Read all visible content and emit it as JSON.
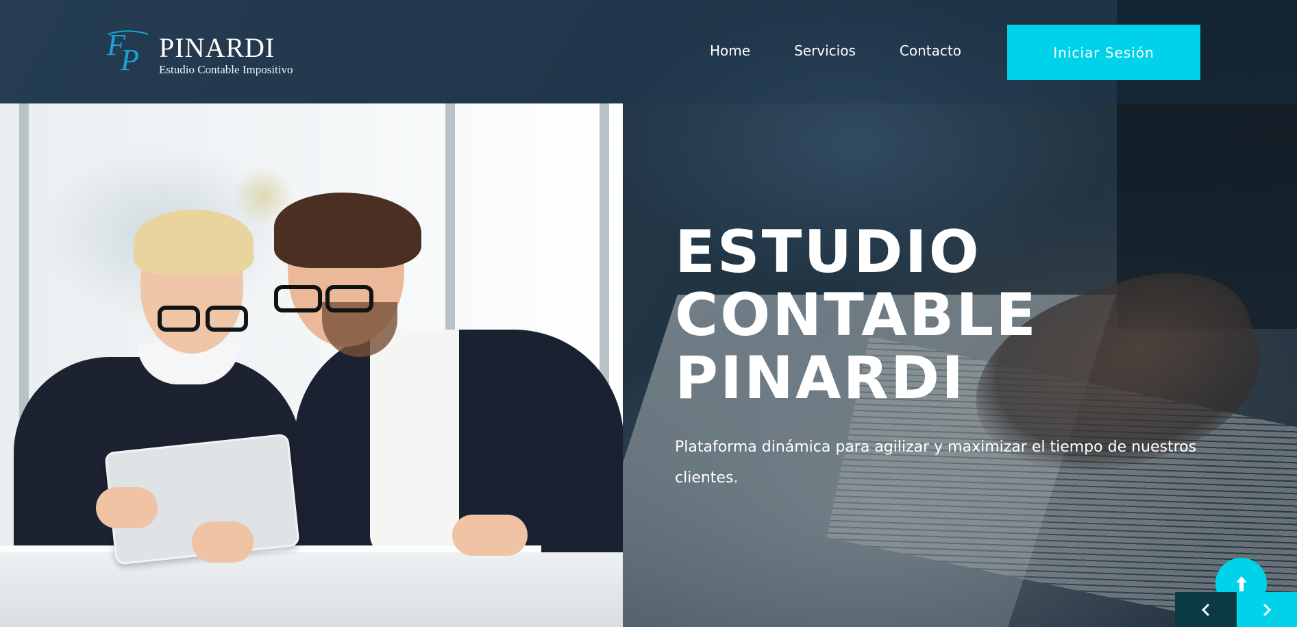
{
  "header": {
    "logo": {
      "mark": "FP",
      "name": "PINARDI",
      "tagline": "Estudio Contable Impositivo"
    },
    "nav": [
      {
        "label": "Home"
      },
      {
        "label": "Servicios"
      },
      {
        "label": "Contacto"
      }
    ],
    "login_label": "Iniciar Sesión"
  },
  "hero": {
    "title_lines": [
      "ESTUDIO",
      "CONTABLE",
      "PINARDI"
    ],
    "subtitle": "Plataforma dinámica para agilizar y maximizar el tiempo de nuestros clientes."
  },
  "controls": {
    "scroll_top_icon": "arrow-up-icon",
    "prev_icon": "chevron-left-icon",
    "next_icon": "chevron-right-icon"
  },
  "colors": {
    "accent": "#00d2ea",
    "dark_control": "#0b3a45",
    "logo_blue": "#1aa3d8"
  }
}
